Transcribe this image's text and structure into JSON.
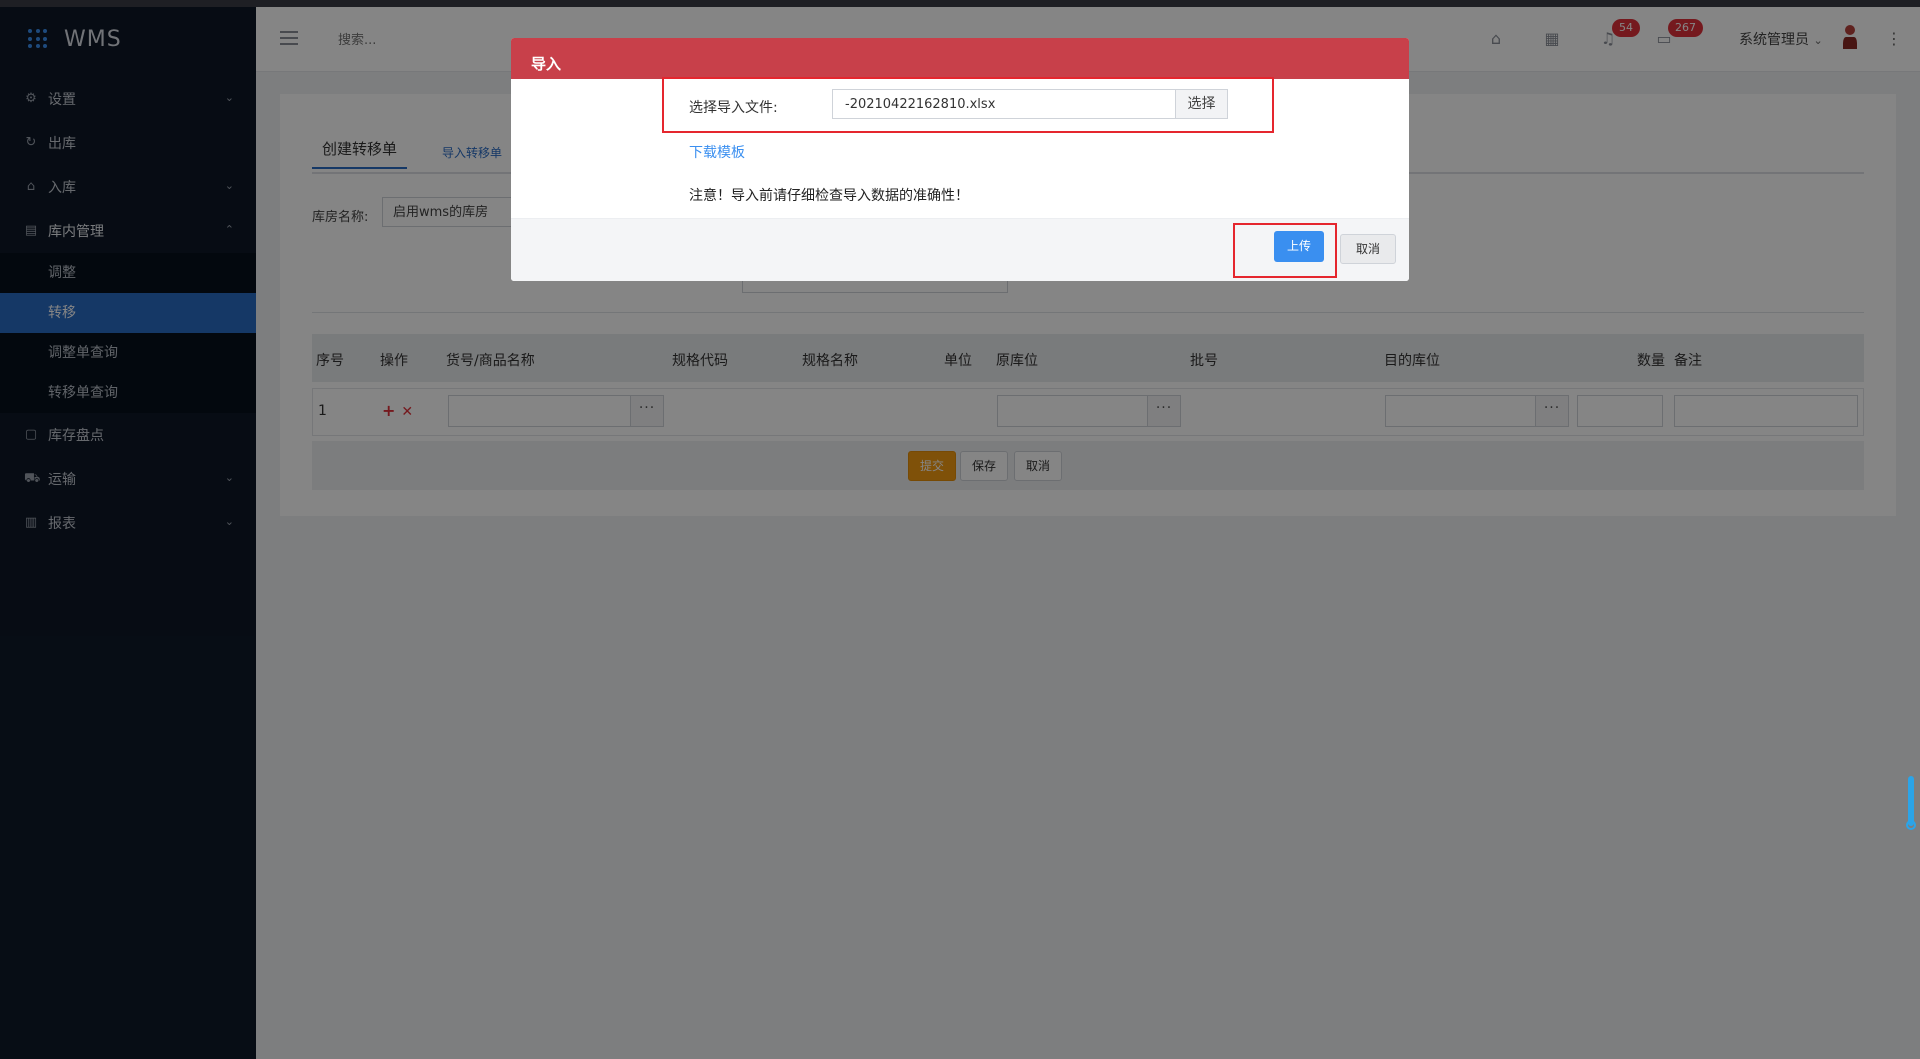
{
  "app": {
    "name": "WMS"
  },
  "sidebar": {
    "items": [
      {
        "label": "设置",
        "icon": "gear-icon"
      },
      {
        "label": "出库",
        "icon": "outbound-icon"
      },
      {
        "label": "入库",
        "icon": "inbound-icon"
      },
      {
        "label": "库内管理",
        "icon": "warehouse-icon"
      },
      {
        "label": "库存盘点",
        "icon": "inventory-icon"
      },
      {
        "label": "运输",
        "icon": "truck-icon"
      },
      {
        "label": "报表",
        "icon": "chart-icon"
      }
    ],
    "sub_items": [
      {
        "label": "调整"
      },
      {
        "label": "转移"
      },
      {
        "label": "调整单查询"
      },
      {
        "label": "转移单查询"
      }
    ]
  },
  "header": {
    "search_placeholder": "搜索...",
    "badges": {
      "notifications": "54",
      "messages": "267"
    },
    "user_name": "系统管理员"
  },
  "page": {
    "tabs": [
      {
        "label": "创建转移单"
      },
      {
        "label": "导入转移单"
      }
    ],
    "warehouse_label": "库房名称:",
    "warehouse_value": "启用wms的库房",
    "table": {
      "headers": [
        "序号",
        "操作",
        "货号/商品名称",
        "规格代码",
        "规格名称",
        "单位",
        "原库位",
        "批号",
        "目的库位",
        "数量",
        "备注"
      ],
      "rows": [
        {
          "index": "1"
        }
      ]
    },
    "buttons": {
      "submit": "提交",
      "save": "保存",
      "cancel": "取消"
    }
  },
  "modal": {
    "title": "导入",
    "file_label": "选择导入文件:",
    "file_value": "-20210422162810.xlsx",
    "choose_label": "选择",
    "download_template": "下载模板",
    "note": "注意！导入前请仔细检查导入数据的准确性！",
    "upload_label": "上传",
    "cancel_label": "取消"
  },
  "colors": {
    "sidebar_bg": "#0e1828",
    "sidebar_active": "#2a6bc4",
    "modal_header": "#c8404a",
    "primary_blue": "#3a8ff0",
    "submit_orange": "#f39c12",
    "highlight_red": "#e5262e"
  }
}
